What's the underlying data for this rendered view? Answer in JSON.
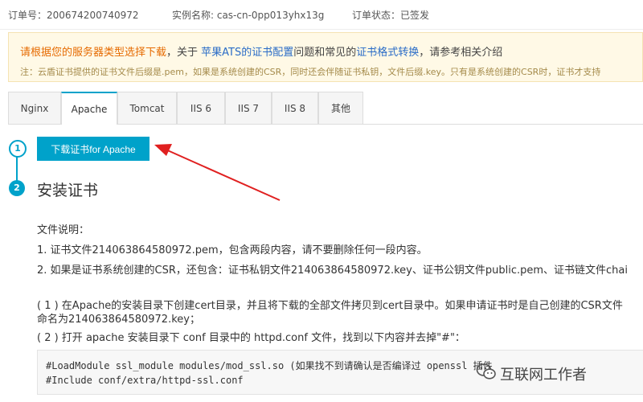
{
  "order": {
    "order_no": "订单号：200674200740972",
    "instance_name": "实例名称: cas-cn-0pp013yhx13g",
    "order_status": "订单状态：已签发"
  },
  "notice": {
    "line1_orange": "请根据您的服务器类型选择下载",
    "line1_sep1": "，关于 ",
    "line1_link1": "苹果ATS的证书配置",
    "line1_mid": "问题和常见的",
    "line1_link2": "证书格式转换",
    "line1_end": "，请参考相关介绍",
    "line2": "注：云盾证书提供的证书文件后缀是.pem，如果是系统创建的CSR，同时还会伴随证书私钥，文件后缀.key。只有是系统创建的CSR时，证书才支持"
  },
  "tabs": [
    {
      "label": "Nginx"
    },
    {
      "label": "Apache"
    },
    {
      "label": "Tomcat"
    },
    {
      "label": "IIS 6"
    },
    {
      "label": "IIS 7"
    },
    {
      "label": "IIS 8"
    },
    {
      "label": "其他"
    }
  ],
  "steps": {
    "step1_number": "1",
    "step2_number": "2",
    "download_label": "下载证书for Apache",
    "install_title": "安装证书"
  },
  "content": {
    "file_desc": "文件说明：",
    "item1": "1. 证书文件214063864580972.pem，包含两段内容，请不要删除任何一段内容。",
    "item2": "2. 如果是证书系统创建的CSR，还包含：证书私钥文件214063864580972.key、证书公钥文件public.pem、证书链文件chai",
    "step_a_line1": "( 1 ) 在Apache的安装目录下创建cert目录，并且将下载的全部文件拷贝到cert目录中。如果申请证书时是自己创建的CSR文件",
    "step_a_line2": "命名为214063864580972.key；",
    "step_b": "( 2 ) 打开 apache 安装目录下 conf 目录中的 httpd.conf 文件，找到以下内容并去掉\"#\"："
  },
  "code": {
    "line1": "#LoadModule ssl_module modules/mod_ssl.so (如果找不到请确认是否编译过 openssl 插件",
    "line2": "#Include conf/extra/httpd-ssl.conf"
  },
  "watermark": {
    "text": "互联网工作者",
    "icon": "wechat-icon"
  },
  "colors": {
    "accent": "#00a2ca",
    "arrow": "#e02020",
    "notice_orange": "#e66a00",
    "link_blue": "#2a6cc7"
  }
}
